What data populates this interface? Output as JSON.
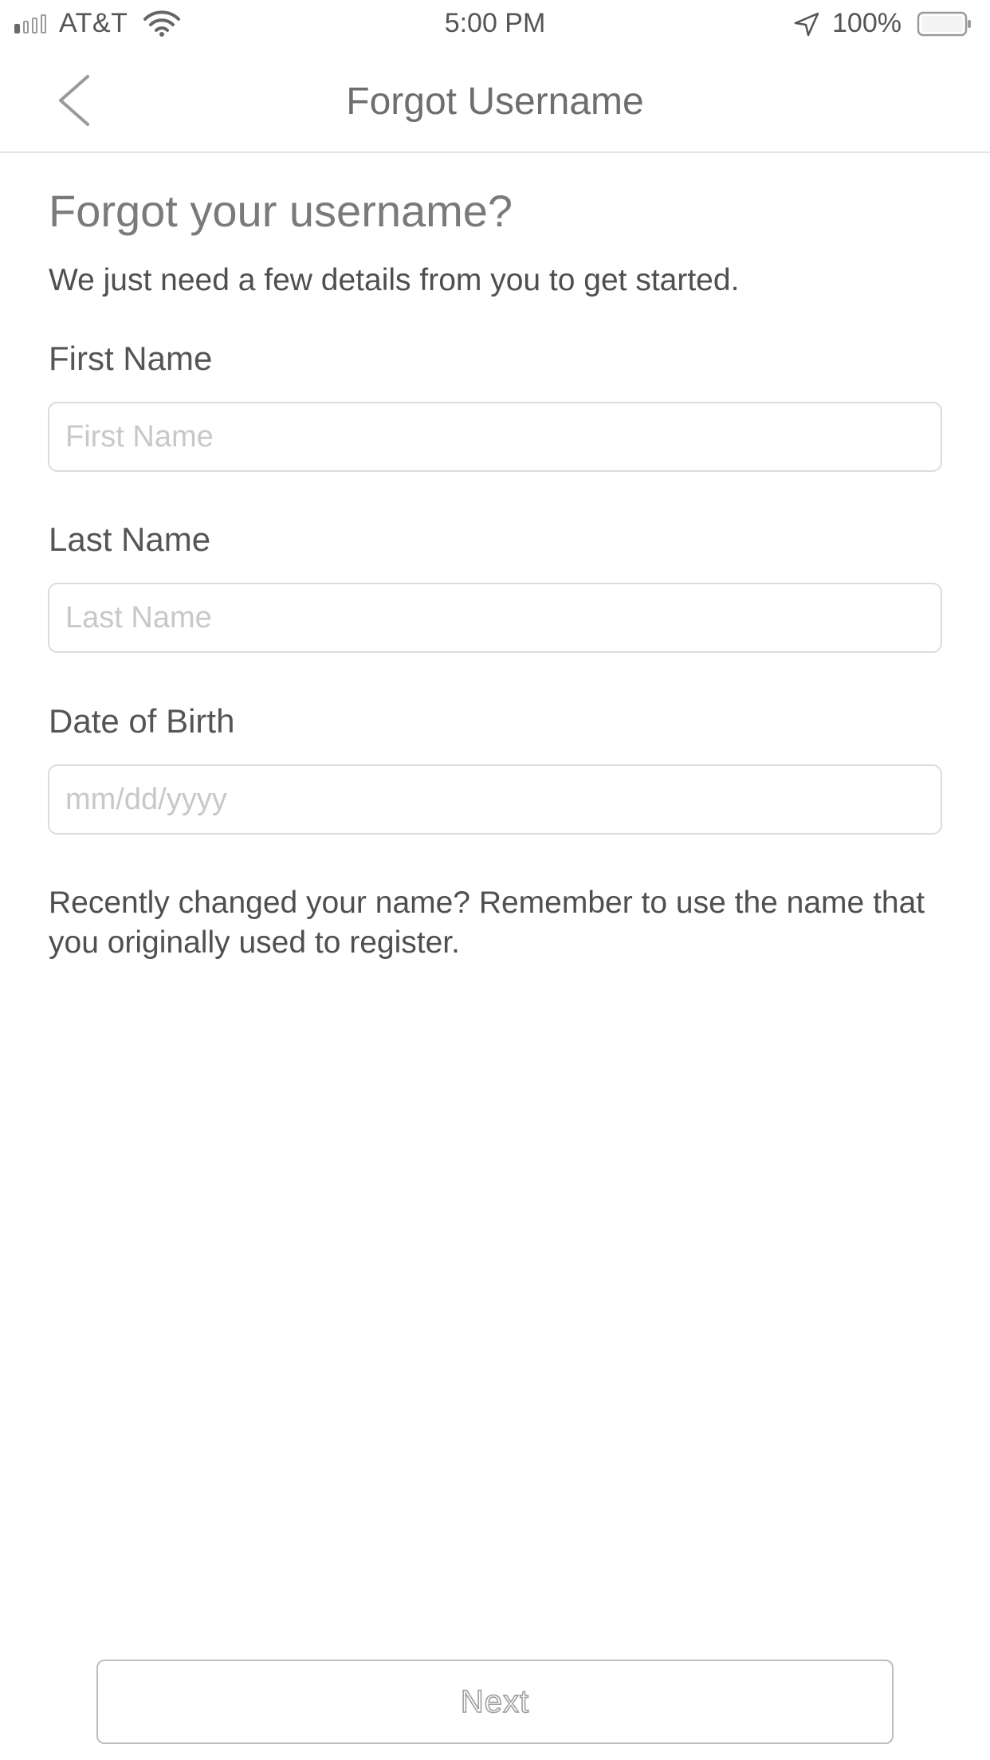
{
  "status_bar": {
    "carrier": "AT&T",
    "time": "5:00 PM",
    "battery_percent": "100%"
  },
  "nav": {
    "title": "Forgot Username",
    "back_icon": "chevron-left-icon"
  },
  "form": {
    "heading": "Forgot your username?",
    "subtitle": "We just need a few details from you to get started.",
    "first_name": {
      "label": "First Name",
      "placeholder": "First Name",
      "value": ""
    },
    "last_name": {
      "label": "Last Name",
      "placeholder": "Last Name",
      "value": ""
    },
    "dob": {
      "label": "Date of Birth",
      "placeholder": "mm/dd/yyyy",
      "value": ""
    },
    "note": "Recently changed your name? Remember to use the name that you originally used to register."
  },
  "actions": {
    "next_label": "Next"
  }
}
